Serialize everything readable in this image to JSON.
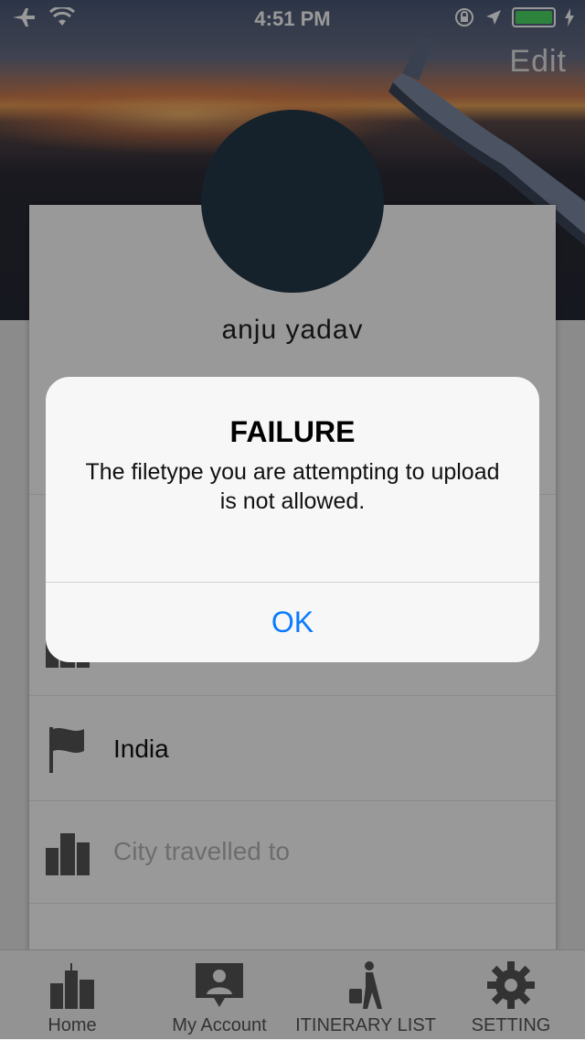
{
  "status_bar": {
    "time": "4:51 PM"
  },
  "header": {
    "edit_label": "Edit"
  },
  "profile": {
    "name": "anju yadav"
  },
  "fields": [
    {
      "icon": "building-icon",
      "value": ""
    },
    {
      "icon": "flag-icon",
      "value": "India"
    },
    {
      "icon": "building-icon",
      "placeholder": "City travelled to"
    }
  ],
  "alert": {
    "title": "FAILURE",
    "message": "The filetype you are attempting to upload is not allowed.",
    "ok_label": "OK"
  },
  "tabbar": {
    "items": [
      {
        "label": "Home",
        "icon": "city-icon"
      },
      {
        "label": "My Account",
        "icon": "account-icon"
      },
      {
        "label": "ITINERARY LIST",
        "icon": "traveler-icon"
      },
      {
        "label": "SETTING",
        "icon": "gear-icon"
      }
    ]
  },
  "colors": {
    "accent": "#0a7aff",
    "battery": "#4cd964",
    "avatar": "#243848"
  }
}
